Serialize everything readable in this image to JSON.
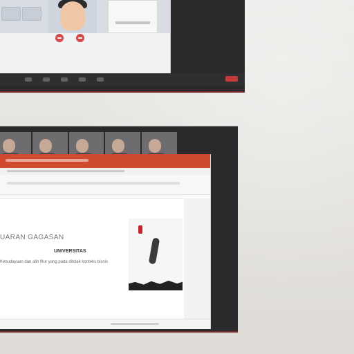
{
  "slide": {
    "title": "UARAN GAGASAN",
    "subtitle": "UNIVERSITAS",
    "body_line": "Kebudayaan dan alih fitur yang pada ditolak konteks bisnis"
  },
  "icons": {
    "meeting_leave": "end-call-icon",
    "mute": "mic-icon",
    "camera": "camera-icon"
  },
  "colors": {
    "accent_orange": "#d04a2d",
    "end_red": "#c33a3a"
  }
}
